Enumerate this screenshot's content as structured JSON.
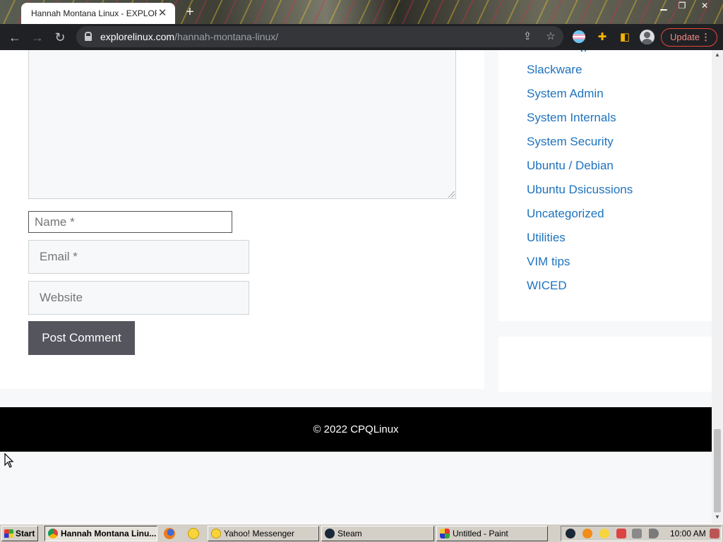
{
  "browser": {
    "tab_title": "Hannah Montana Linux - EXPLORE",
    "tab_close": "✕",
    "new_tab": "+",
    "url_host": "explorelinux.com",
    "url_path": "/hannah-montana-linux/",
    "update_label": "Update"
  },
  "comment_form": {
    "name_placeholder": "Name *",
    "email_placeholder": "Email *",
    "website_placeholder": "Website",
    "submit_label": "Post Comment"
  },
  "sidebar": {
    "categories": [
      "Slackware",
      "System Admin",
      "System Internals",
      "System Security",
      "Ubuntu / Debian",
      "Ubuntu Dsicussions",
      "Uncategorized",
      "Utilities",
      "VIM tips",
      "WICED"
    ],
    "link_color": "#1e73be"
  },
  "footer": {
    "copyright": "© 2022 CPQLinux"
  },
  "taskbar": {
    "start_label": "Start",
    "tasks": [
      {
        "label": "Hannah Montana Linu...",
        "icon": "chrome-icon"
      },
      {
        "label": "Yahoo! Messenger",
        "icon": "yahoo-messenger-icon"
      },
      {
        "label": "Steam",
        "icon": "steam-icon"
      },
      {
        "label": "Untitled - Paint",
        "icon": "paint-icon"
      }
    ],
    "clock": "10:00 AM"
  }
}
